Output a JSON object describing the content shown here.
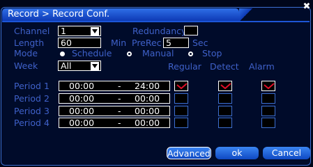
{
  "window": {
    "title": "Record > Record Conf.",
    "close_glyph": "✖"
  },
  "channel": {
    "label": "Channel",
    "value": "1"
  },
  "redundancy": {
    "label": "Redundancy"
  },
  "length": {
    "label": "Length",
    "value": "60",
    "unit": "Min"
  },
  "prerec": {
    "label": "PreRec",
    "value": "5",
    "unit": "Sec"
  },
  "mode": {
    "label": "Mode",
    "options": [
      {
        "label": "Schedule",
        "selected": true
      },
      {
        "label": "Manual",
        "selected": false
      },
      {
        "label": "Stop",
        "selected": false
      }
    ]
  },
  "week": {
    "label": "Week",
    "value": "All"
  },
  "columns": {
    "regular": "Regular",
    "detect": "Detect",
    "alarm": "Alarm"
  },
  "periods": [
    {
      "label": "Period 1",
      "start": "00:00",
      "sep": "-",
      "end": "24:00",
      "regular": true,
      "detect": true,
      "alarm": true
    },
    {
      "label": "Period 2",
      "start": "00:00",
      "sep": "-",
      "end": "00:00",
      "regular": false,
      "detect": false,
      "alarm": false
    },
    {
      "label": "Period 3",
      "start": "00:00",
      "sep": "-",
      "end": "00:00",
      "regular": false,
      "detect": false,
      "alarm": false
    },
    {
      "label": "Period 4",
      "start": "00:00",
      "sep": "-",
      "end": "00:00",
      "regular": false,
      "detect": false,
      "alarm": false
    }
  ],
  "buttons": {
    "advanced": "Advanced",
    "ok": "ok",
    "cancel": "Cancel"
  },
  "colors": {
    "label": "#3f61c9",
    "accent": "#2f6fe8",
    "check": "#e0102a",
    "background": "#000b2a"
  }
}
